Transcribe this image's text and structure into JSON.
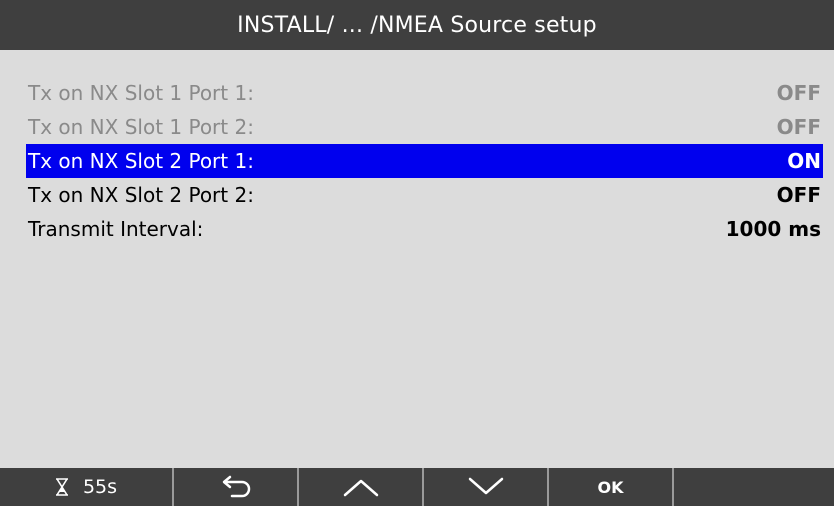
{
  "header": {
    "title": "INSTALL/ ... /NMEA Source setup"
  },
  "menu": {
    "items": [
      {
        "label": "Tx on NX Slot 1 Port 1:",
        "value": "OFF",
        "state": "disabled"
      },
      {
        "label": "Tx on NX Slot 1 Port 2:",
        "value": "OFF",
        "state": "disabled"
      },
      {
        "label": "Tx on NX Slot 2 Port 1:",
        "value": "ON",
        "state": "selected"
      },
      {
        "label": "Tx on NX Slot 2 Port 2:",
        "value": "OFF",
        "state": "normal"
      },
      {
        "label": "Transmit Interval:",
        "value": "1000 ms",
        "state": "normal"
      }
    ]
  },
  "footer": {
    "timer": "55s",
    "timer_icon": "hourglass-icon",
    "back_icon": "back-arrow-icon",
    "up_icon": "chevron-up-icon",
    "down_icon": "chevron-down-icon",
    "ok_label": "OK"
  },
  "colors": {
    "title_bar": "#3f3f3f",
    "background": "#dcdcdc",
    "selection": "#0000ee",
    "disabled_text": "#8a8a8a"
  }
}
